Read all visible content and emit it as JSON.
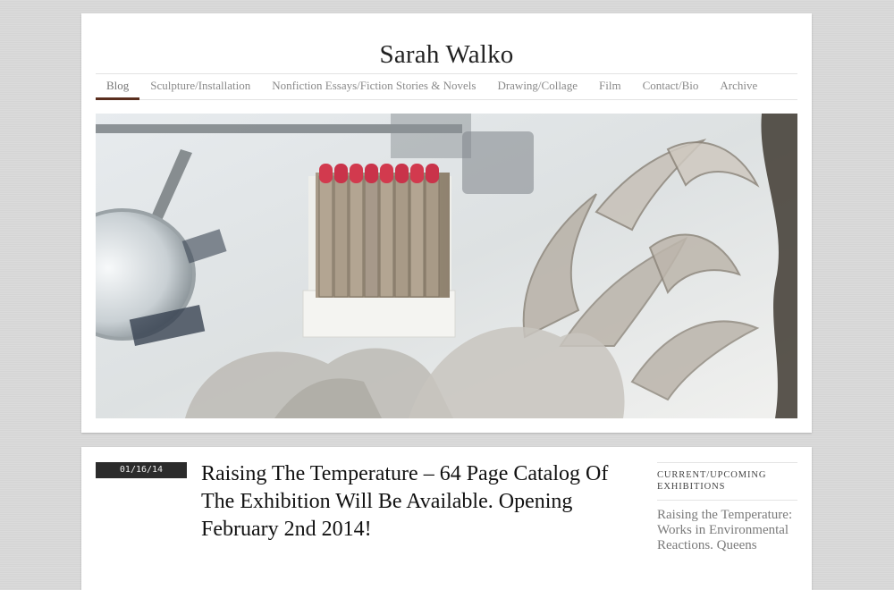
{
  "site": {
    "title": "Sarah Walko"
  },
  "nav": {
    "items": [
      {
        "label": "Blog",
        "active": true
      },
      {
        "label": "Sculpture/Installation",
        "active": false
      },
      {
        "label": "Nonfiction Essays/Fiction Stories & Novels",
        "active": false
      },
      {
        "label": "Drawing/Collage",
        "active": false
      },
      {
        "label": "Film",
        "active": false
      },
      {
        "label": "Contact/Bio",
        "active": false
      },
      {
        "label": "Archive",
        "active": false
      }
    ],
    "accent_color": "#5a2e1e"
  },
  "hero": {
    "matches_color": "#d23a4e"
  },
  "post": {
    "date": "01/16/14",
    "title": "Raising The Temperature – 64 Page Catalog Of The Exhibition Will Be Available. Opening February 2nd 2014!"
  },
  "sidebar": {
    "heading": "Current/Upcoming Exhibitions",
    "text": "Raising the Temperature: Works in Environmental Reactions. Queens"
  }
}
